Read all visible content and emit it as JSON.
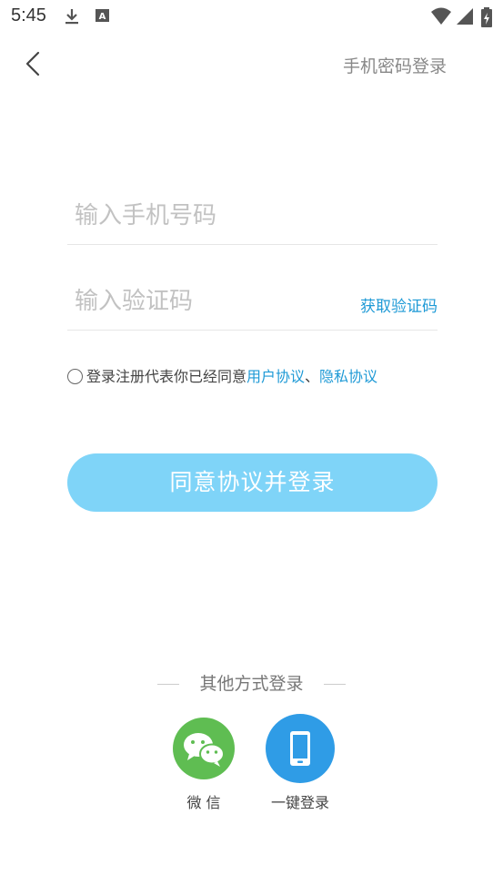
{
  "status_bar": {
    "time": "5:45",
    "icons": [
      "download-icon",
      "font-icon",
      "wifi-icon",
      "signal-icon",
      "battery-icon"
    ]
  },
  "header": {
    "back_icon": "chevron-left-icon",
    "password_login_label": "手机密码登录"
  },
  "form": {
    "phone_placeholder": "输入手机号码",
    "code_placeholder": "输入验证码",
    "get_code_label": "获取验证码"
  },
  "agreement": {
    "prefix": "登录注册代表你已经同意",
    "user_agreement": "用户协议",
    "separator": "、",
    "privacy_agreement": "隐私协议"
  },
  "login_button_label": "同意协议并登录",
  "other_login": {
    "title": "其他方式登录",
    "wechat_label": "微 信",
    "one_key_label": "一键登录"
  },
  "colors": {
    "accent_link": "#1f9ad6",
    "button_bg": "#7fd4f8",
    "wechat_green": "#5fbd52",
    "phone_blue": "#2f9ce6"
  }
}
